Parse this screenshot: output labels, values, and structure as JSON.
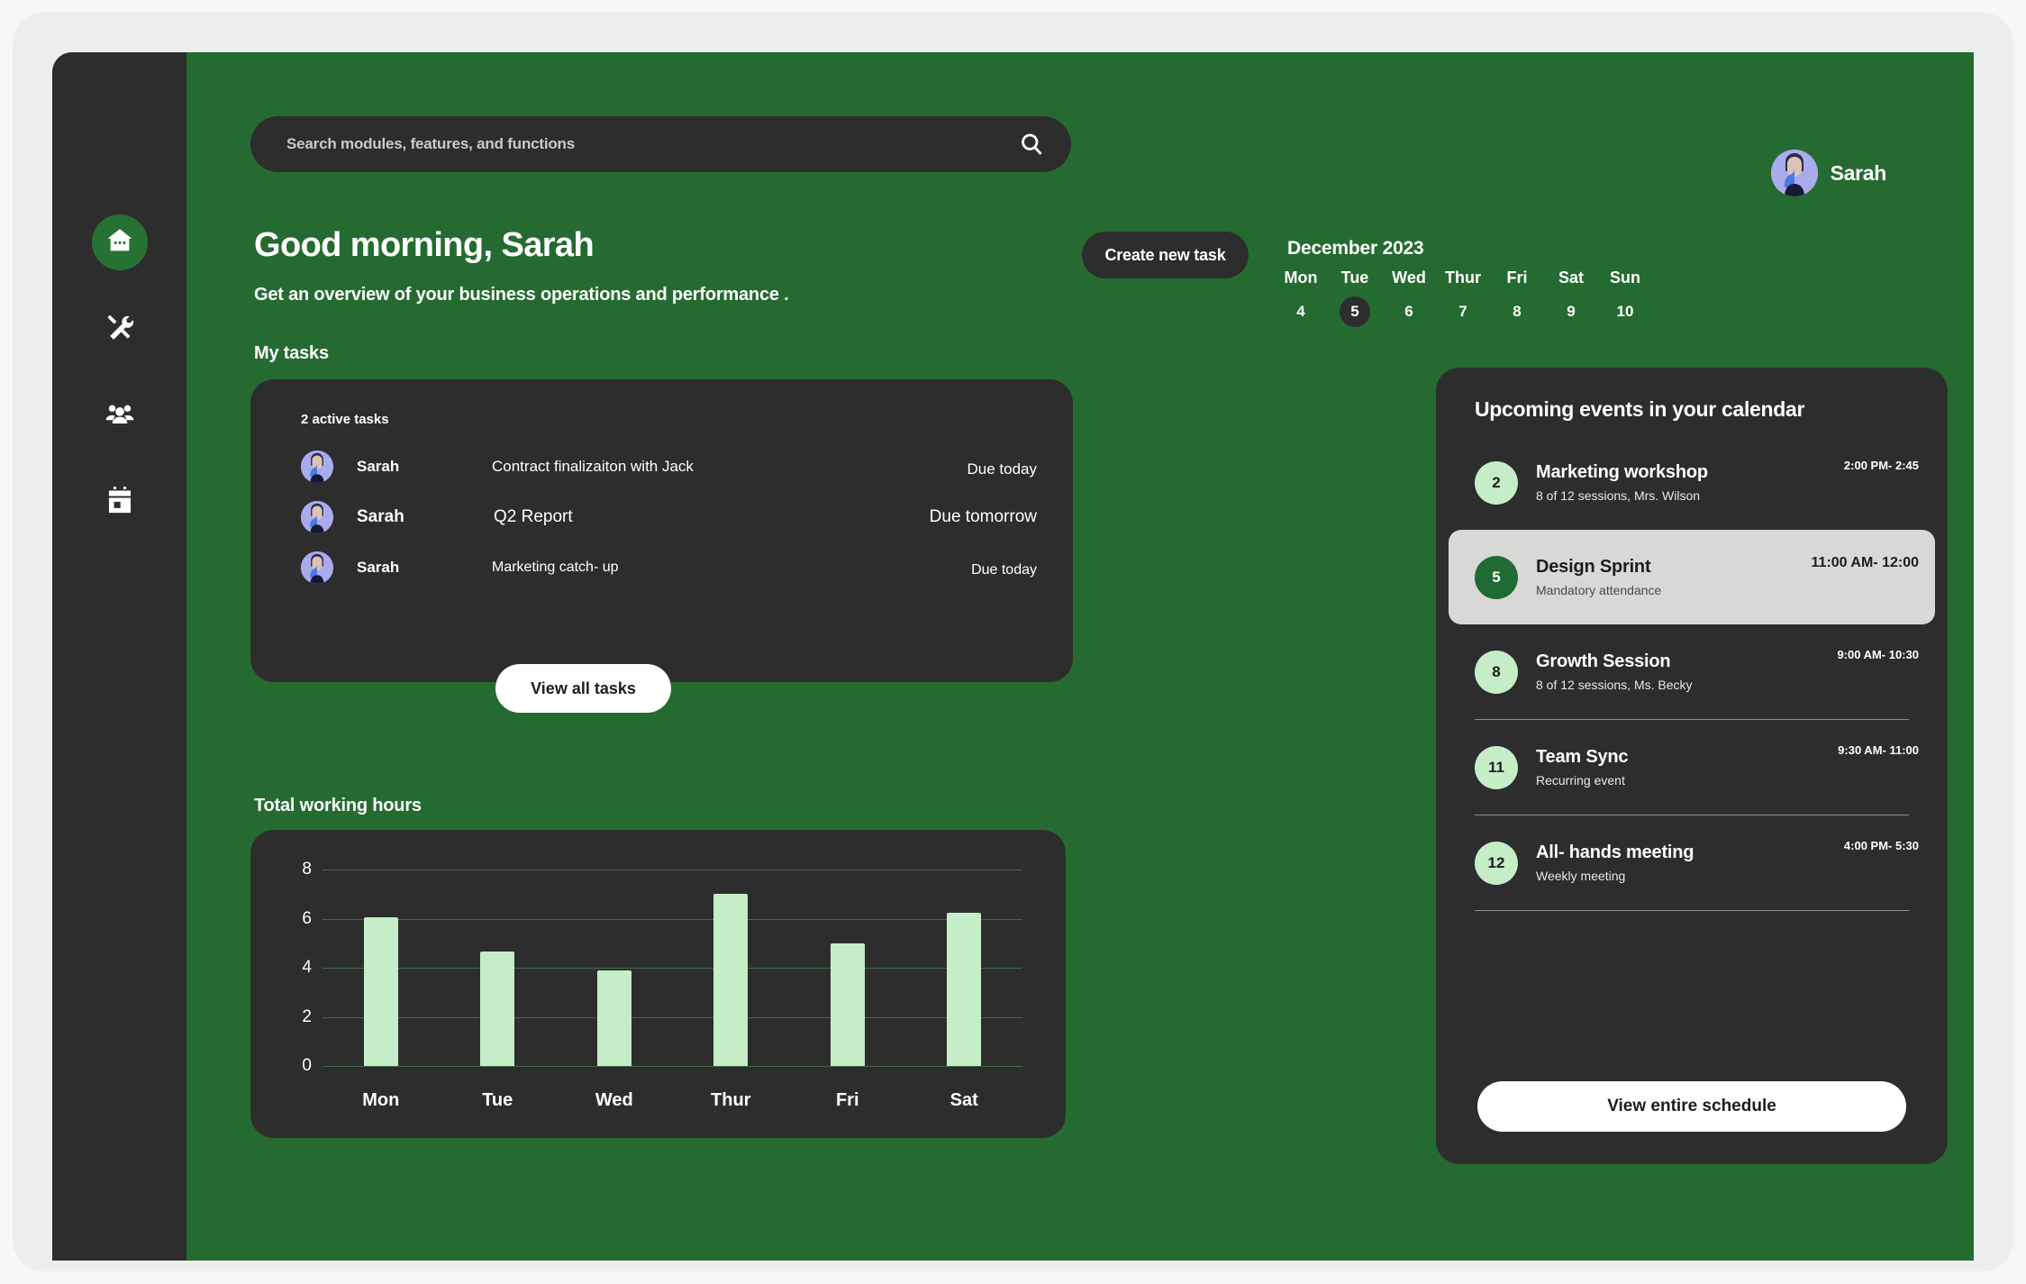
{
  "theme": {
    "green_bg": "#256b31",
    "panel_dark": "#2d2d2d",
    "accent_light_green": "#c5edc8",
    "highlight_gray": "#d8d8d6",
    "dark_green_badge": "#1f6b33"
  },
  "sidebar": {
    "items": [
      {
        "name": "home",
        "icon": "home-icon",
        "active": true
      },
      {
        "name": "tools",
        "icon": "tools-icon",
        "active": false
      },
      {
        "name": "team",
        "icon": "people-icon",
        "active": false
      },
      {
        "name": "calendar",
        "icon": "calendar-icon",
        "active": false
      }
    ]
  },
  "search": {
    "placeholder": "Search modules, features, and functions",
    "value": "",
    "icon": "search-icon"
  },
  "profile": {
    "name": "Sarah",
    "avatar": "user-avatar"
  },
  "header": {
    "greeting": "Good morning, Sarah",
    "subtitle": "Get an overview of your business operations and performance .",
    "create_task_label": "Create new task"
  },
  "tasks": {
    "section_title": "My tasks",
    "count_label": "2 active tasks",
    "view_all_label": "View all tasks",
    "rows": [
      {
        "user": "Sarah",
        "title": "Contract finalizaiton with Jack",
        "due": "Due today"
      },
      {
        "user": "Sarah",
        "title": "Q2 Report",
        "due": "Due tomorrow"
      },
      {
        "user": "Sarah",
        "title": "Marketing catch- up",
        "due": "Due today"
      }
    ]
  },
  "chart_data": {
    "type": "bar",
    "title": "Total working hours",
    "categories": [
      "Mon",
      "Tue",
      "Wed",
      "Thur",
      "Fri",
      "Sat"
    ],
    "values": [
      6.05,
      4.65,
      3.9,
      7.0,
      5.0,
      6.25
    ],
    "ticks": [
      8,
      6,
      4,
      2,
      0
    ],
    "ylim": [
      0,
      8
    ],
    "xlabel": "",
    "ylabel": "",
    "grid": true,
    "legend": "none",
    "bar_color": "#c5edc8"
  },
  "calendar": {
    "month": "December 2023",
    "days": [
      {
        "dow": "Mon",
        "num": "4",
        "selected": false
      },
      {
        "dow": "Tue",
        "num": "5",
        "selected": true
      },
      {
        "dow": "Wed",
        "num": "6",
        "selected": false
      },
      {
        "dow": "Thur",
        "num": "7",
        "selected": false
      },
      {
        "dow": "Fri",
        "num": "8",
        "selected": false
      },
      {
        "dow": "Sat",
        "num": "9",
        "selected": false
      },
      {
        "dow": "Sun",
        "num": "10",
        "selected": false
      }
    ]
  },
  "events": {
    "title": "Upcoming events in your calendar",
    "schedule_label": "View entire schedule",
    "items": [
      {
        "day": "2",
        "name": "Marketing workshop",
        "sub": "8 of 12 sessions, Mrs. Wilson",
        "time": "2:00 PM- 2:45",
        "highlight": false,
        "divider": false
      },
      {
        "day": "5",
        "name": "Design Sprint",
        "sub": "Mandatory attendance",
        "time": "11:00 AM- 12:00",
        "highlight": true,
        "divider": false
      },
      {
        "day": "8",
        "name": "Growth Session",
        "sub": "8 of 12 sessions, Ms. Becky",
        "time": "9:00 AM- 10:30",
        "highlight": false,
        "divider": true
      },
      {
        "day": "11",
        "name": "Team Sync",
        "sub": "Recurring event",
        "time": "9:30 AM- 11:00",
        "highlight": false,
        "divider": true
      },
      {
        "day": "12",
        "name": "All- hands meeting",
        "sub": "Weekly meeting",
        "time": "4:00 PM- 5:30",
        "highlight": false,
        "divider": true
      }
    ]
  }
}
